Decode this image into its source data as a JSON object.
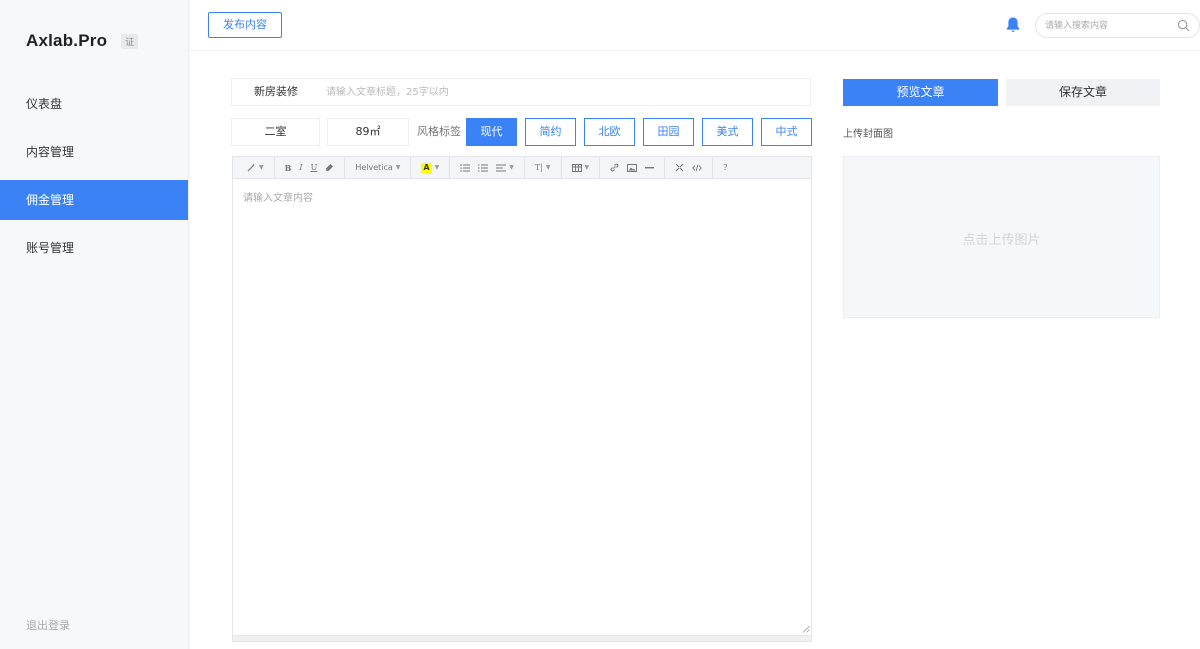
{
  "brand": {
    "name": "Axlab.Pro",
    "badge": "证"
  },
  "sidebar": {
    "items": [
      {
        "label": "仪表盘",
        "active": false
      },
      {
        "label": "内容管理",
        "active": false
      },
      {
        "label": "佣金管理",
        "active": true
      },
      {
        "label": "账号管理",
        "active": false
      }
    ],
    "logout": "退出登录"
  },
  "header": {
    "publish_label": "发布内容",
    "search_placeholder": "请输入搜索内容"
  },
  "article": {
    "category": "新房装修",
    "title_placeholder": "请输入文章标题，25字以内",
    "rooms": "二室",
    "area": "89㎡",
    "style_label": "风格标签",
    "styles": [
      {
        "label": "现代",
        "active": true
      },
      {
        "label": "简约",
        "active": false
      },
      {
        "label": "北欧",
        "active": false
      },
      {
        "label": "田园",
        "active": false
      },
      {
        "label": "美式",
        "active": false
      },
      {
        "label": "中式",
        "active": false
      }
    ],
    "content_placeholder": "请输入文章内容"
  },
  "toolbar": {
    "bold": "B",
    "italic": "I",
    "underline": "U",
    "font": "Helvetica",
    "highlight": "A",
    "text_size": "T|",
    "help": "?"
  },
  "panel": {
    "preview_label": "预览文章",
    "save_label": "保存文章",
    "cover_label": "上传封面图",
    "upload_label": "点击上传图片"
  },
  "colors": {
    "accent": "#3b82f6",
    "sidebar_bg": "#f7f8fa"
  }
}
